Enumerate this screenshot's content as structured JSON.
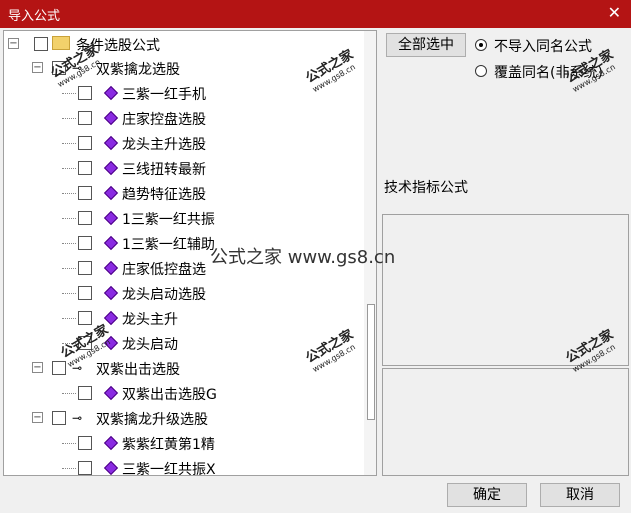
{
  "window": {
    "title": "导入公式"
  },
  "tree": {
    "root": "条件选股公式",
    "groups": [
      {
        "label": "双紫擒龙选股",
        "items": [
          "三紫一红手机",
          "庄家控盘选股",
          "龙头主升选股",
          "三线扭转最新",
          "趋势特征选股",
          "1三紫一红共振",
          "1三紫一红辅助",
          "庄家低控盘选",
          "龙头启动选股",
          "龙头主升",
          "龙头启动"
        ]
      },
      {
        "label": "双紫出击选股",
        "items": [
          "双紫出击选股G"
        ]
      },
      {
        "label": "双紫擒龙升级选股",
        "items": [
          "紫紫红黄第1精",
          "三紫一红共振X"
        ]
      }
    ]
  },
  "buttons": {
    "select_all": "全部选中",
    "ok": "确定",
    "cancel": "取消"
  },
  "options": {
    "no_import": "不导入同名公式",
    "overwrite": "覆盖同名(非系统)"
  },
  "info_label": "技术指标公式",
  "watermark": {
    "text": "公式之家 www.gs8.cn",
    "small": "公式之家",
    "url": "www.gs8.cn"
  }
}
